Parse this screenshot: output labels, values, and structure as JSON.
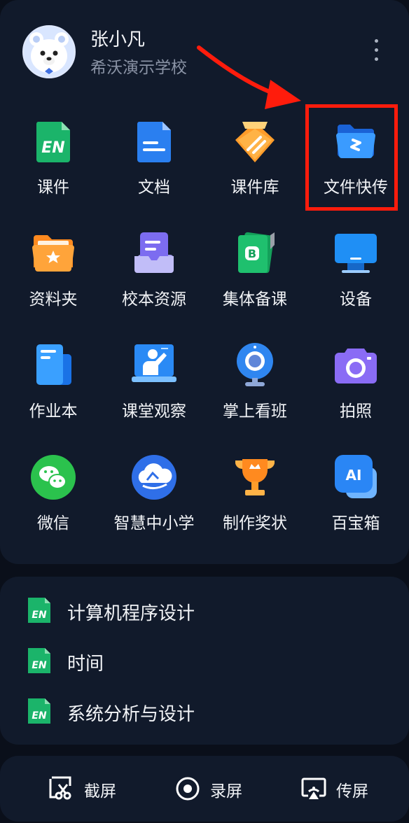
{
  "user": {
    "name": "张小凡",
    "school": "希沃演示学校"
  },
  "apps": [
    {
      "label": "课件",
      "icon": "courseware-icon"
    },
    {
      "label": "文档",
      "icon": "document-icon"
    },
    {
      "label": "课件库",
      "icon": "courseware-library-icon"
    },
    {
      "label": "文件快传",
      "icon": "file-transfer-icon"
    },
    {
      "label": "资料夹",
      "icon": "folder-star-icon"
    },
    {
      "label": "校本资源",
      "icon": "school-resource-icon"
    },
    {
      "label": "集体备课",
      "icon": "collective-prep-icon"
    },
    {
      "label": "设备",
      "icon": "monitor-icon"
    },
    {
      "label": "作业本",
      "icon": "homework-icon"
    },
    {
      "label": "课堂观察",
      "icon": "classroom-observe-icon"
    },
    {
      "label": "掌上看班",
      "icon": "webcam-icon"
    },
    {
      "label": "拍照",
      "icon": "camera-icon"
    },
    {
      "label": "微信",
      "icon": "wechat-icon"
    },
    {
      "label": "智慧中小学",
      "icon": "smart-school-icon"
    },
    {
      "label": "制作奖状",
      "icon": "trophy-icon"
    },
    {
      "label": "百宝箱",
      "icon": "ai-toolbox-icon"
    }
  ],
  "recent": [
    {
      "label": "计算机程序设计",
      "icon": "courseware-file-icon"
    },
    {
      "label": "时间",
      "icon": "courseware-file-icon"
    },
    {
      "label": "系统分析与设计",
      "icon": "courseware-file-icon"
    }
  ],
  "tools": [
    {
      "label": "截屏",
      "icon": "screenshot-icon"
    },
    {
      "label": "录屏",
      "icon": "record-icon"
    },
    {
      "label": "传屏",
      "icon": "cast-screen-icon"
    }
  ],
  "colors": {
    "background": "#0a0f1a",
    "panel": "#111a2b",
    "highlight": "#ff1c0c",
    "primary_text": "#f2f4f7",
    "secondary_text": "#8a93a5"
  }
}
